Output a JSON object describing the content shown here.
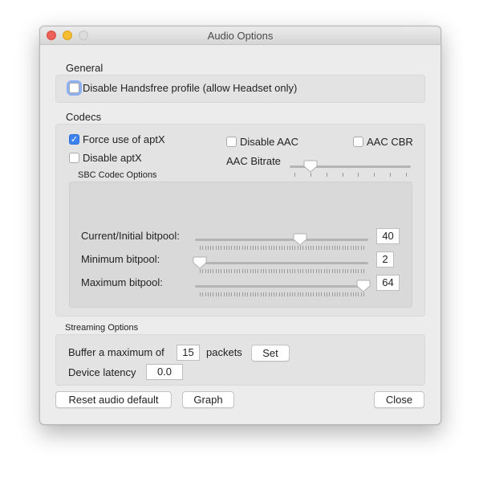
{
  "window": {
    "title": "Audio Options"
  },
  "general": {
    "label": "General",
    "disable_handsfree": {
      "label": "Disable Handsfree profile (allow Headset only)",
      "checked": false,
      "focused": true
    }
  },
  "codecs": {
    "label": "Codecs",
    "force_aptx": {
      "label": "Force use of aptX",
      "checked": true
    },
    "disable_aptx": {
      "label": "Disable aptX",
      "checked": false
    },
    "disable_aac": {
      "label": "Disable AAC",
      "checked": false
    },
    "aac_cbr": {
      "label": "AAC CBR",
      "checked": false
    },
    "aac_bitrate": {
      "label": "AAC Bitrate",
      "tick_count": 8,
      "selected_tick_index": 1
    },
    "sbc": {
      "label": "SBC Codec Options",
      "rows": [
        {
          "label": "Current/Initial bitpool:",
          "value": "40",
          "min": 2,
          "max": 64
        },
        {
          "label": "Minimum bitpool:",
          "value": "2",
          "min": 2,
          "max": 64
        },
        {
          "label": "Maximum bitpool:",
          "value": "64",
          "min": 2,
          "max": 64
        }
      ]
    }
  },
  "streaming": {
    "label": "Streaming Options",
    "buffer_prefix": "Buffer a maximum of",
    "buffer_value": "15",
    "buffer_suffix": "packets",
    "set_label": "Set",
    "latency_label": "Device latency",
    "latency_value": "0.0"
  },
  "footer": {
    "reset_label": "Reset audio default",
    "graph_label": "Graph",
    "close_label": "Close"
  }
}
